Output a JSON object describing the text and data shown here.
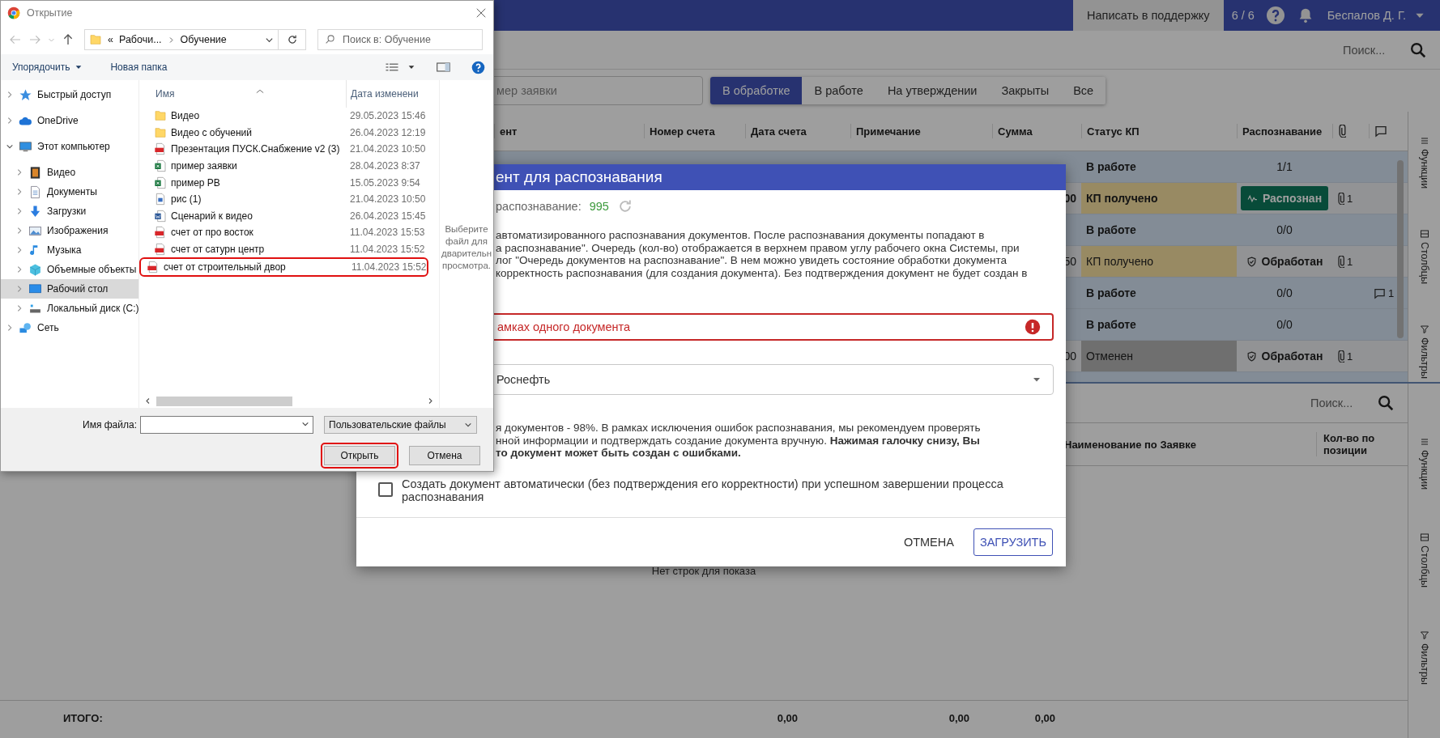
{
  "app": {
    "support_button": "Написать в поддержку",
    "queue": "6 / 6",
    "user": "Беспалов Д. Г.",
    "search": {
      "placeholder": "Поиск..."
    },
    "request_search": {
      "placeholder": "мер заявки"
    },
    "tabs": [
      {
        "label": "В обработке",
        "selected": true
      },
      {
        "label": "В работе",
        "selected": false
      },
      {
        "label": "На утверждении",
        "selected": false
      },
      {
        "label": "Закрыты",
        "selected": false
      },
      {
        "label": "Все",
        "selected": false
      }
    ],
    "table": {
      "columns": [
        "ент",
        "Номер счета",
        "Дата счета",
        "Примечание",
        "Сумма",
        "Статус КП",
        "Распознавание"
      ],
      "rows": [
        {
          "status": "В работе",
          "kind": "in_work",
          "bold": true,
          "recognition": {
            "kind": "count",
            "text": "1/1"
          }
        },
        {
          "sum": "00",
          "status": "КП получено",
          "kind": "received",
          "bold": true,
          "recognition": {
            "kind": "button",
            "text": "Распознан"
          },
          "attachments": "1"
        },
        {
          "status": "В работе",
          "kind": "in_work",
          "bold": true,
          "recognition": {
            "kind": "count",
            "text": "0/0"
          }
        },
        {
          "sum": "50",
          "status": "КП получено",
          "kind": "received",
          "bold": false,
          "recognition": {
            "kind": "done",
            "text": "Обработан"
          },
          "attachments": "1"
        },
        {
          "status": "В работе",
          "kind": "in_work",
          "bold": true,
          "recognition": {
            "kind": "count",
            "text": "0/0"
          },
          "comments": "1"
        },
        {
          "status": "В работе",
          "kind": "in_work",
          "bold": true,
          "recognition": {
            "kind": "count",
            "text": "0/0"
          }
        },
        {
          "sum": "00",
          "status": "Отменен",
          "kind": "cancelled",
          "bold": false,
          "recognition": {
            "kind": "done",
            "text": "Обработан"
          },
          "attachments": "1"
        }
      ]
    },
    "side_tabs": [
      "Функции",
      "Столбцы",
      "Фильтры"
    ],
    "bottom": {
      "search": {
        "placeholder": "Поиск..."
      },
      "columns": [
        "Наименование по Заявке",
        "Кол-во по позиции"
      ],
      "empty": "Нет строк для показа",
      "total_label": "ИТОГО:",
      "totals": [
        "0,00",
        "0,00",
        "0,00"
      ],
      "side_tabs": [
        "Функции",
        "Столбцы",
        "Фильтры"
      ]
    }
  },
  "modal": {
    "title": "ент для распознавания",
    "queue_label": "распознавание:",
    "queue_value": "995",
    "info_lines": [
      "автоматизированного распознавания документов. После распознавания документы попадают в",
      "а распознавание\". Очередь (кол-во) отображается в верхнем правом углу рабочего окна Системы, при",
      "лог \"Очередь документов на распознавание\". В нем можно увидеть состояние обработки документа",
      "корректность распознавания (для создания документа). Без подтверждения документ не будет создан в"
    ],
    "error_text": "амках одного документа",
    "organization": {
      "value": "Роснефть"
    },
    "warning_lines": [
      "я документов - 98%. В рамках исключения ошибок распознавания, мы рекомендуем проверять",
      "нной информации и подтверждать создание документа вручную. **Нажимая галочку снизу, Вы**",
      "**то документ может быть создан с ошибками.**"
    ],
    "auto_create": {
      "label": "Создать документ автоматически (без подтверждения его корректности) при успешном завершении процесса распознавания",
      "checked": false
    },
    "buttons": [
      {
        "label": "ОТМЕНА",
        "kind": "text"
      },
      {
        "label": "ЗАГРУЗИТЬ",
        "kind": "outlined"
      }
    ]
  },
  "file_dialog": {
    "title": "Открытие",
    "address": {
      "overflow": "«",
      "crumbs": [
        "Рабочи...",
        "Обучение"
      ]
    },
    "search": {
      "placeholder": "Поиск в: Обучение"
    },
    "toolbar": [
      "Упорядочить",
      "Новая папка"
    ],
    "nav": [
      {
        "label": "Быстрый доступ",
        "kind": "quick",
        "expanded": false,
        "selected": false
      },
      {
        "label": "OneDrive",
        "kind": "cloud",
        "expanded": false,
        "selected": false
      },
      {
        "label": "Этот компьютер",
        "kind": "pc",
        "expanded": true,
        "selected": false,
        "children": [
          {
            "label": "Видео",
            "kind": "video",
            "expanded": false,
            "selected": false
          },
          {
            "label": "Документы",
            "kind": "docs",
            "expanded": false,
            "selected": false
          },
          {
            "label": "Загрузки",
            "kind": "downloads",
            "expanded": false,
            "selected": false
          },
          {
            "label": "Изображения",
            "kind": "images",
            "expanded": false,
            "selected": false
          },
          {
            "label": "Музыка",
            "kind": "music",
            "expanded": false,
            "selected": false
          },
          {
            "label": "Объемные объекты",
            "kind": "objects",
            "expanded": false,
            "selected": false
          },
          {
            "label": "Рабочий стол",
            "kind": "desktop",
            "expanded": false,
            "selected": true
          },
          {
            "label": "Локальный диск (C:)",
            "kind": "disk",
            "expanded": false,
            "selected": false
          }
        ]
      },
      {
        "label": "Сеть",
        "kind": "network",
        "expanded": false,
        "selected": false
      }
    ],
    "columns": [
      "Имя",
      "Дата изменени"
    ],
    "files": [
      {
        "name": "Видео",
        "kind": "folder",
        "modified": "29.05.2023 15:46",
        "highlighted": false
      },
      {
        "name": "Видео с обучений",
        "kind": "folder",
        "modified": "26.04.2023 12:19",
        "highlighted": false
      },
      {
        "name": "Презентация ПУСК.Снабжение v2 (3)",
        "kind": "pdf",
        "modified": "21.04.2023 10:50",
        "highlighted": false
      },
      {
        "name": "пример заявки",
        "kind": "excel",
        "modified": "28.04.2023 8:37",
        "highlighted": false
      },
      {
        "name": "пример РВ",
        "kind": "excel",
        "modified": "15.05.2023 9:54",
        "highlighted": false
      },
      {
        "name": "рис (1)",
        "kind": "image",
        "modified": "21.04.2023 10:50",
        "highlighted": false
      },
      {
        "name": "Сценарий к видео",
        "kind": "word",
        "modified": "26.04.2023 15:45",
        "highlighted": false
      },
      {
        "name": "счет от про восток",
        "kind": "pdf",
        "modified": "11.04.2023 15:53",
        "highlighted": false
      },
      {
        "name": "счет от сатурн центр",
        "kind": "pdf",
        "modified": "11.04.2023 15:52",
        "highlighted": false
      },
      {
        "name": "счет от строительный двор",
        "kind": "pdf",
        "modified": "11.04.2023 15:52",
        "highlighted": true
      }
    ],
    "preview_hint": [
      "Выберите",
      "файл для",
      "дварительн",
      "просмотра."
    ],
    "filename_label": "Имя файла:",
    "file_type": "Пользовательские файлы",
    "buttons": [
      {
        "label": "Открыть",
        "highlighted": true
      },
      {
        "label": "Отмена",
        "highlighted": false
      }
    ]
  }
}
